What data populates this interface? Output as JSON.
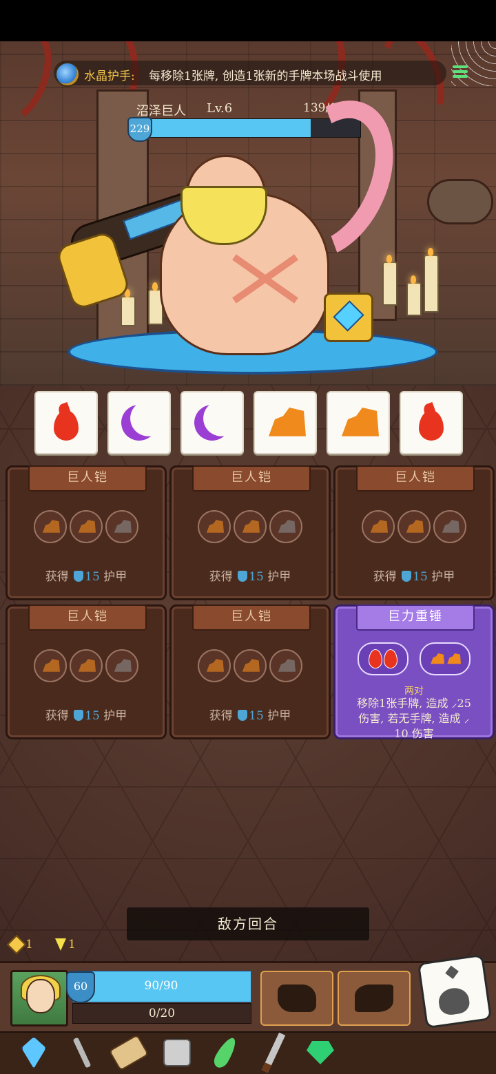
{
  "buff": {
    "name": "水晶护手:",
    "description": "每移除1张牌, 创造1张新的手牌本场战斗使用"
  },
  "enemy": {
    "name": "沼泽巨人",
    "level": "Lv.6",
    "hp": 139,
    "hp_max": 180,
    "hp_text": "139/180",
    "shield": "229"
  },
  "hand_dice": [
    {
      "face": "fire"
    },
    {
      "face": "moon"
    },
    {
      "face": "moon"
    },
    {
      "face": "rock"
    },
    {
      "face": "rock"
    },
    {
      "face": "fire"
    }
  ],
  "cards": [
    {
      "title": "巨人铠",
      "gain_text": "获得",
      "value": "15",
      "unit": "护甲"
    },
    {
      "title": "巨人铠",
      "gain_text": "获得",
      "value": "15",
      "unit": "护甲"
    },
    {
      "title": "巨人铠",
      "gain_text": "获得",
      "value": "15",
      "unit": "护甲"
    },
    {
      "title": "巨人铠",
      "gain_text": "获得",
      "value": "15",
      "unit": "护甲"
    },
    {
      "title": "巨人铠",
      "gain_text": "获得",
      "value": "15",
      "unit": "护甲"
    }
  ],
  "special_card": {
    "title": "巨力重锤",
    "pair_label": "两对",
    "effect_line1": "移除1张手牌, 造成 ⸝25",
    "effect_line2": "伤害, 若无手牌, 造成 ⸝",
    "effect_line3": "10 伤害"
  },
  "turn_banner": "敌方回合",
  "resources": {
    "diamond": "1",
    "energy": "1"
  },
  "player": {
    "shield": "60",
    "hp": 90,
    "hp_max": 90,
    "hp_text": "90/90",
    "xp": 0,
    "xp_max": 20,
    "xp_text": "0/20"
  },
  "icons": {
    "buff": "crystal-gauntlet-icon",
    "menu": "menu-icon",
    "skill1": "fist-icon",
    "skill2": "claw-icon",
    "die": "dice-icon",
    "inventory": [
      "crystal-icon",
      "moon-staff-icon",
      "scroll-icon",
      "stone-die-icon",
      "feather-icon",
      "dagger-icon",
      "emerald-icon"
    ]
  },
  "colors": {
    "hp_fill": "#57c6f2",
    "fire": "#e8331e",
    "moon": "#9b3fd4",
    "rock": "#f08a1c",
    "special_card": "#7a4fc2",
    "accent_gold": "#f5c84a"
  }
}
